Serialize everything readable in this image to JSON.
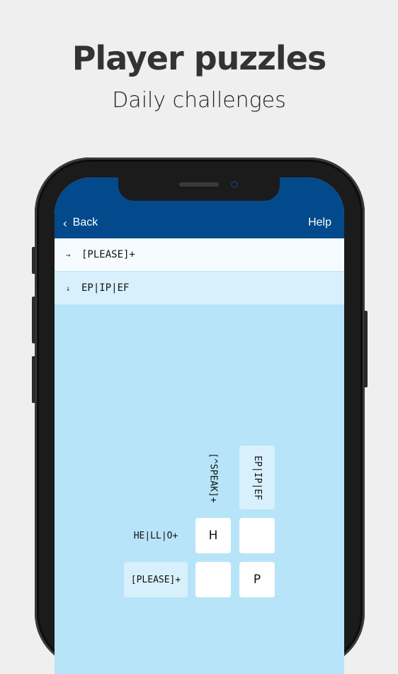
{
  "promo": {
    "title": "Player puzzles",
    "subtitle": "Daily challenges"
  },
  "nav": {
    "back_label": "Back",
    "help_label": "Help"
  },
  "clues": [
    {
      "direction_icon": "right-arrow-icon",
      "text": "[PLEASE]+"
    },
    {
      "direction_icon": "down-arrow-icon",
      "text": "EP|IP|EF"
    }
  ],
  "grid": {
    "column_clues": [
      "[^SPEAK]+",
      "EP|IP|EF"
    ],
    "row_clues": [
      "HE|LL|O+",
      "[PLEASE]+"
    ],
    "cells": [
      [
        "H",
        ""
      ],
      [
        "",
        "P"
      ]
    ]
  },
  "colors": {
    "nav_bar": "#034a8c",
    "board_bg": "#b7e4f8",
    "highlight": "#d8f0fc",
    "page_bg": "#efefef"
  }
}
